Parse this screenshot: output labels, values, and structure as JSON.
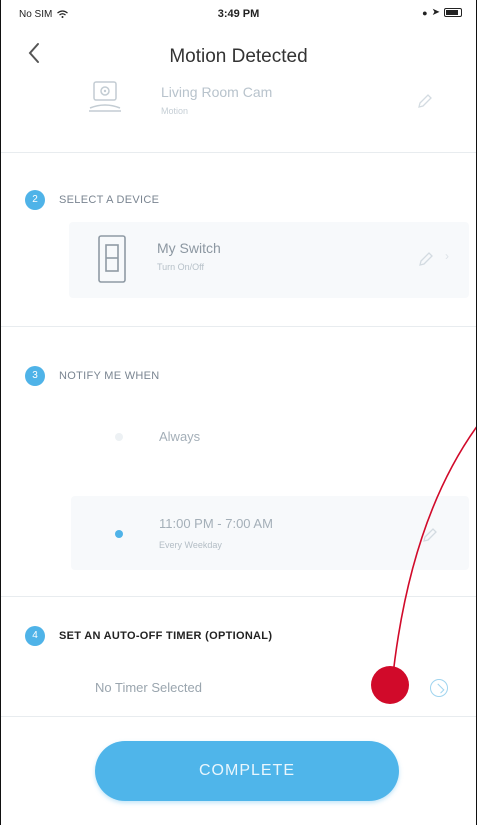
{
  "status_bar": {
    "carrier": "No SIM",
    "time": "3:49 PM"
  },
  "nav": {
    "title": "Motion Detected",
    "back_icon": "chevron-left-icon"
  },
  "trigger_device": {
    "name": "Living Room Cam",
    "subtitle": "Motion",
    "icon": "camera-icon"
  },
  "sections": {
    "select_device": {
      "step": "2",
      "label": "SELECT A DEVICE"
    },
    "notify": {
      "step": "3",
      "label": "NOTIFY ME WHEN"
    },
    "timer": {
      "step": "4",
      "label": "SET AN AUTO-OFF TIMER (OPTIONAL)"
    }
  },
  "device": {
    "name": "My Switch",
    "subtitle": "Turn On/Off",
    "icon": "switch-icon"
  },
  "notify_options": [
    {
      "label": "Always",
      "sub": "",
      "selected": false
    },
    {
      "label": "11:00 PM - 7:00 AM",
      "sub": "Every Weekday",
      "selected": true
    }
  ],
  "timer": {
    "placeholder": "No Timer Selected",
    "icon": "info-icon"
  },
  "complete_button": {
    "label": "COMPLETE"
  },
  "colors": {
    "accent": "#4fb3e8",
    "annotation": "#d10a2a"
  }
}
